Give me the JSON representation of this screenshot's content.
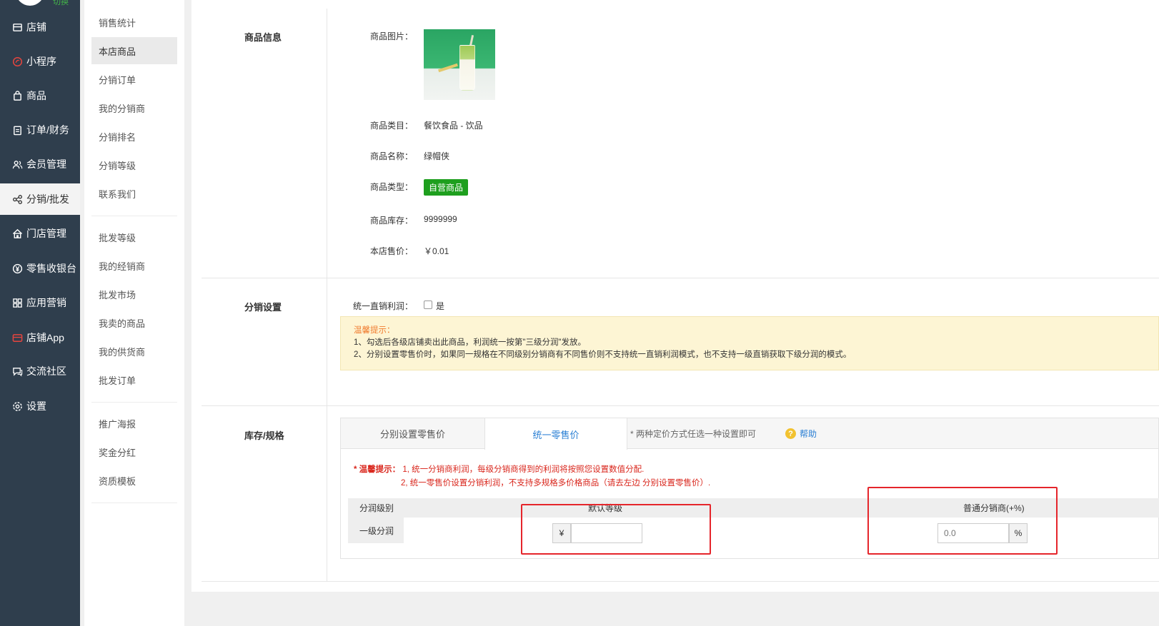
{
  "sidebar": {
    "switch_text": "切换",
    "items": [
      {
        "label": "店铺",
        "icon": "store-icon"
      },
      {
        "label": "小程序",
        "icon": "miniprogram-icon"
      },
      {
        "label": "商品",
        "icon": "bag-icon"
      },
      {
        "label": "订单/财务",
        "icon": "clipboard-icon"
      },
      {
        "label": "会员管理",
        "icon": "users-icon"
      },
      {
        "label": "分销/批发",
        "icon": "share-icon",
        "active": true
      },
      {
        "label": "门店管理",
        "icon": "home-icon"
      },
      {
        "label": "零售收银台",
        "icon": "yen-icon"
      },
      {
        "label": "应用营销",
        "icon": "apps-icon"
      },
      {
        "label": "店铺App",
        "icon": "app-icon"
      },
      {
        "label": "交流社区",
        "icon": "chat-icon"
      },
      {
        "label": "设置",
        "icon": "gear-icon"
      }
    ]
  },
  "subnav": {
    "group1": [
      "销售统计",
      "本店商品",
      "分销订单",
      "我的分销商",
      "分销排名",
      "分销等级",
      "联系我们"
    ],
    "group2": [
      "批发等级",
      "我的经销商",
      "批发市场",
      "我卖的商品",
      "我的供货商",
      "批发订单"
    ],
    "group3": [
      "推广海报",
      "奖金分红",
      "资质模板"
    ],
    "active": "本店商品"
  },
  "product": {
    "section_title": "商品信息",
    "image_label": "商品图片：",
    "category_label": "商品类目：",
    "category_value": "餐饮食品 - 饮品",
    "name_label": "商品名称：",
    "name_value": "绿帽侠",
    "type_label": "商品类型：",
    "type_badge": "自营商品",
    "stock_label": "商品库存：",
    "stock_value": "9999999",
    "price_label": "本店售价：",
    "price_value": "￥0.01"
  },
  "distribution": {
    "section_title": "分销设置",
    "unified_label": "统一直销利润：",
    "checkbox_label": "是",
    "notice_title": "温馨提示：",
    "notice_line1": "1、勾选后各级店铺卖出此商品，利润统一按第\"三级分润\"发放。",
    "notice_line2": "2、分别设置零售价时，如果同一规格在不同级别分销商有不同售价则不支持统一直销利润模式，也不支持一级直销获取下级分润的模式。"
  },
  "stock": {
    "section_title": "库存/规格",
    "tab1": "分别设置零售价",
    "tab2": "统一零售价",
    "tab_hint": "* 两种定价方式任选一种设置即可",
    "help": "帮助",
    "tip_prefix": "* 温馨提示：",
    "tip_line1": "1, 统一分销商利润，每级分销商得到的利润将按照您设置数值分配.",
    "tip_line2": "2, 统一零售价设置分销利润，不支持多规格多价格商品（请去左边 分别设置零售价）.",
    "col_level": "分润级别",
    "col_default": "默认等级",
    "col_normal": "普通分销商(+%)",
    "row_label": "一级分润",
    "currency": "¥",
    "percent_placeholder": "0.0",
    "percent_unit": "%"
  },
  "colors": {
    "sidebar_bg": "#2f3e4d",
    "badge": "#1e9f1e",
    "accent": "#2a7fd4",
    "warning": "#d9261c",
    "highlight_box": "#e5252b"
  }
}
